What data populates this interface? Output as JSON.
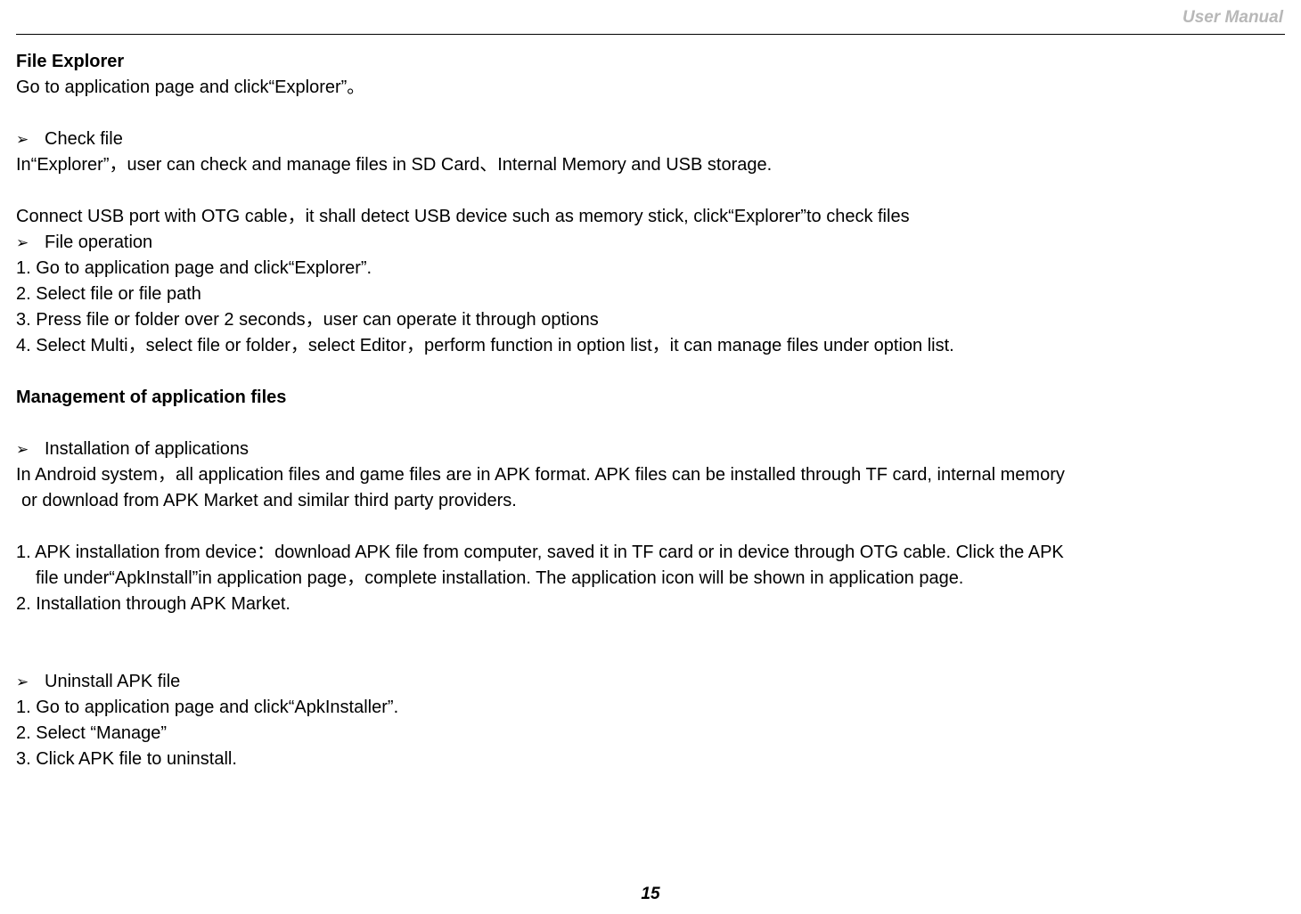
{
  "header": {
    "right_label": "User Manual"
  },
  "section1": {
    "title": "File Explorer",
    "intro": "Go to application page and click“Explorer”。",
    "bullet1": "Check file",
    "p1": "In“Explorer”，user can check and manage files in SD Card、Internal Memory and USB storage.",
    "p2": "Connect USB port with OTG cable，it shall detect USB device such as memory stick, click“Explorer”to check files",
    "bullet2": "File operation",
    "op1": "1. Go to application page and click“Explorer”.",
    "op2": "2. Select file or file path",
    "op3": "3. Press file or folder over 2 seconds，user can operate it through options",
    "op4": "4. Select Multi，select file or folder，select Editor，perform function in option list，it can manage files under option list."
  },
  "section2": {
    "title": "Management of application files",
    "bullet1": "Installation of applications",
    "p1": "In Android system，all application files and game files are in APK format. APK files can be installed through TF card, internal memory",
    "p1b": "or download from APK Market and similar third party providers.",
    "op1": "1. APK installation from device：download APK file from computer, saved it in TF card or in device through OTG cable. Click the APK",
    "op1b": "file under“ApkInstall”in application page，complete installation. The application icon will be shown in application page.",
    "op2": "2. Installation through APK Market.",
    "bullet2": "Uninstall APK file",
    "u1": "1. Go to application page and click“ApkInstaller”.",
    "u2": "2. Select “Manage”",
    "u3": "3. Click APK file to uninstall."
  },
  "footer": {
    "page_number": "15"
  }
}
